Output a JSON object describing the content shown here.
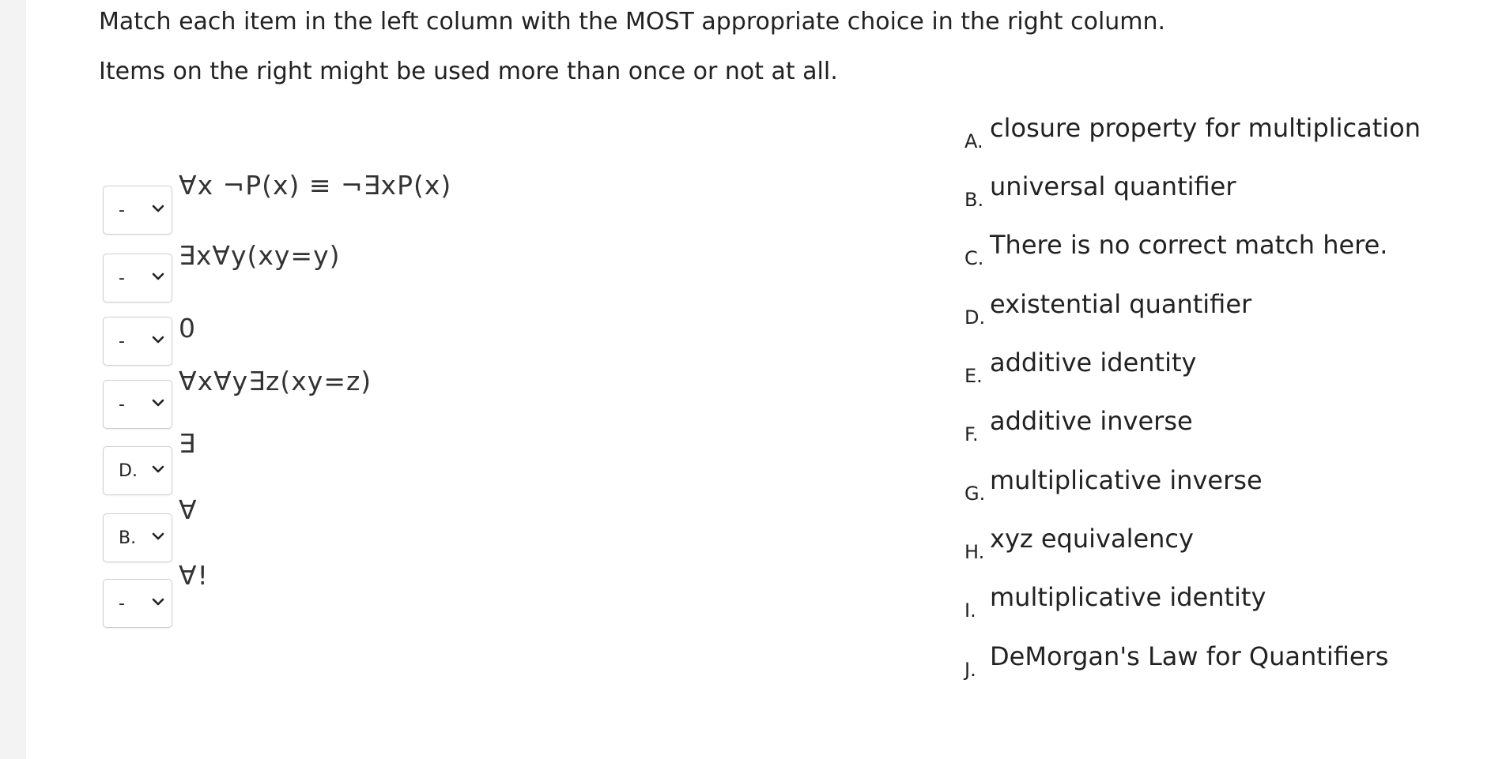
{
  "instructions": {
    "line1": "Match each item in the left column with the MOST appropriate choice in the right column.",
    "line2": "Items on the right might be used more than once or not at all."
  },
  "left_items": [
    {
      "selected": "-",
      "text": "∀x ¬P(x) ≡ ¬∃xP(x)"
    },
    {
      "selected": "-",
      "text": "∃x∀y(xy=y)"
    },
    {
      "selected": "-",
      "text": "0"
    },
    {
      "selected": "-",
      "text": "∀x∀y∃z(xy=z)"
    },
    {
      "selected": "D.",
      "text": "∃"
    },
    {
      "selected": "B.",
      "text": "∀"
    },
    {
      "selected": "-",
      "text": "∀!"
    }
  ],
  "choices": [
    {
      "letter": "A.",
      "text": "closure property for multiplication"
    },
    {
      "letter": "B.",
      "text": "universal quantifier"
    },
    {
      "letter": "C.",
      "text": "There is no correct match here."
    },
    {
      "letter": "D.",
      "text": "existential quantifier"
    },
    {
      "letter": "E.",
      "text": "additive identity"
    },
    {
      "letter": "F.",
      "text": "additive inverse"
    },
    {
      "letter": "G.",
      "text": "multiplicative inverse"
    },
    {
      "letter": "H.",
      "text": "xyz equivalency"
    },
    {
      "letter": "I.",
      "text": "multiplicative identity"
    },
    {
      "letter": "J.",
      "text": "DeMorgan's Law for Quantifiers"
    }
  ]
}
